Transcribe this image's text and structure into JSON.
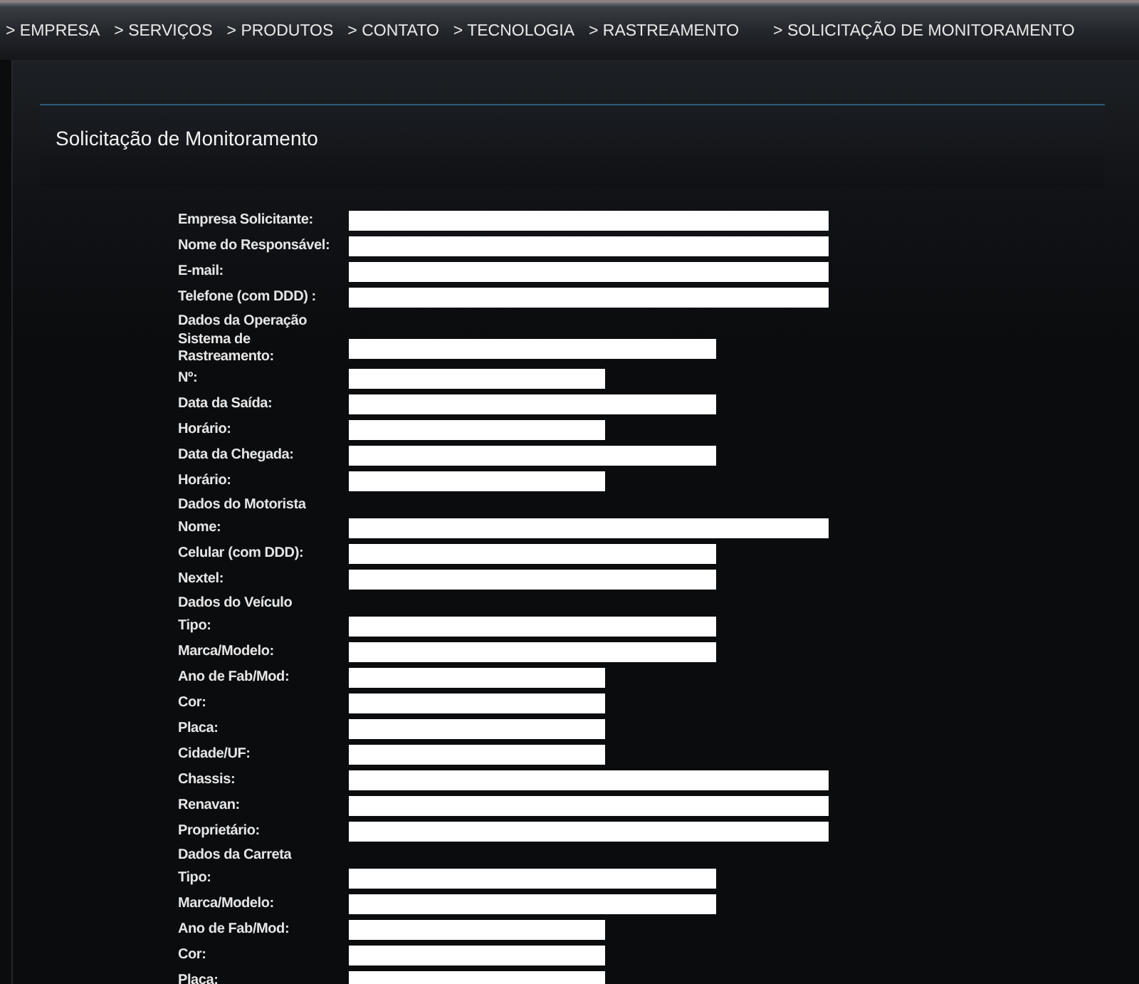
{
  "nav": [
    {
      "label": "> EMPRESA"
    },
    {
      "label": "> SERVIÇOS"
    },
    {
      "label": "> PRODUTOS"
    },
    {
      "label": "> CONTATO"
    },
    {
      "label": "> TECNOLOGIA"
    },
    {
      "label": "> RASTREAMENTO"
    },
    {
      "label": "> SOLICITAÇÃO DE MONITORAMENTO"
    }
  ],
  "page_title": "Solicitação de Monitoramento",
  "form": [
    {
      "kind": "long",
      "label": "Empresa Solicitante:"
    },
    {
      "kind": "long",
      "label": "Nome do Responsável:"
    },
    {
      "kind": "long",
      "label": "E-mail:"
    },
    {
      "kind": "long",
      "label": "Telefone (com DDD) :"
    },
    {
      "kind": "heading",
      "label": "Dados da Operação"
    },
    {
      "kind": "medium",
      "label": "Sistema de Rastreamento:"
    },
    {
      "kind": "short",
      "label": "Nº:"
    },
    {
      "kind": "medium",
      "label": "Data da Saída:"
    },
    {
      "kind": "short",
      "label": "Horário:"
    },
    {
      "kind": "medium",
      "label": "Data da Chegada:"
    },
    {
      "kind": "short",
      "label": "Horário:"
    },
    {
      "kind": "heading",
      "label": "Dados do Motorista"
    },
    {
      "kind": "long",
      "label": "Nome:"
    },
    {
      "kind": "medium",
      "label": "Celular (com DDD):"
    },
    {
      "kind": "medium",
      "label": "Nextel:"
    },
    {
      "kind": "heading",
      "label": "Dados do Veículo"
    },
    {
      "kind": "medium",
      "label": "Tipo:"
    },
    {
      "kind": "medium",
      "label": "Marca/Modelo:"
    },
    {
      "kind": "short",
      "label": "Ano de Fab/Mod:"
    },
    {
      "kind": "short",
      "label": "Cor:"
    },
    {
      "kind": "short",
      "label": "Placa:"
    },
    {
      "kind": "short",
      "label": "Cidade/UF:"
    },
    {
      "kind": "long",
      "label": "Chassis:"
    },
    {
      "kind": "long",
      "label": "Renavan:"
    },
    {
      "kind": "long",
      "label": "Proprietário:"
    },
    {
      "kind": "heading",
      "label": "Dados da Carreta"
    },
    {
      "kind": "medium",
      "label": "Tipo:"
    },
    {
      "kind": "medium",
      "label": "Marca/Modelo:"
    },
    {
      "kind": "short",
      "label": "Ano de Fab/Mod:"
    },
    {
      "kind": "short",
      "label": "Cor:"
    },
    {
      "kind": "short",
      "label": "Placa:"
    }
  ]
}
